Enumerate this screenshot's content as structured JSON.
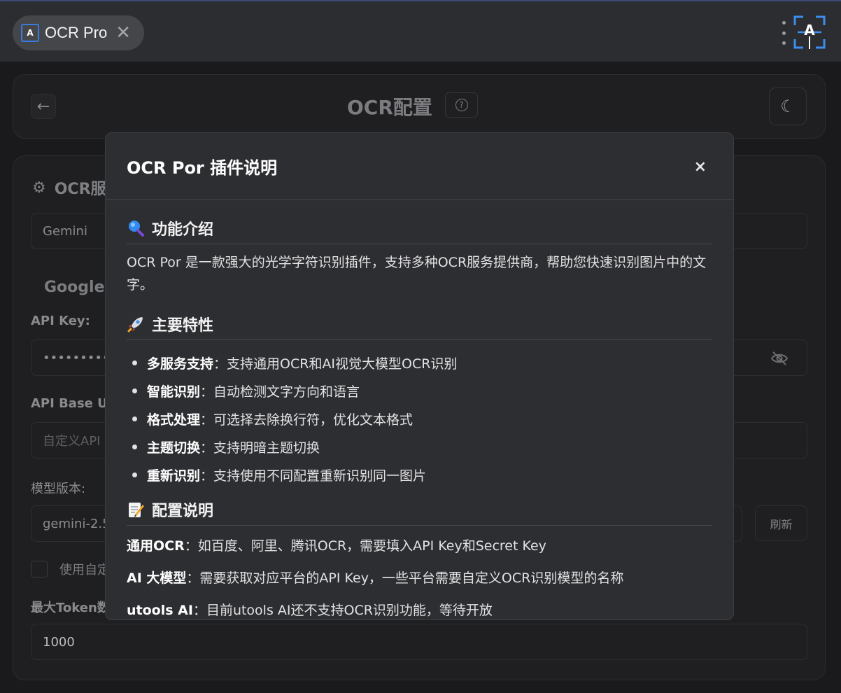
{
  "topbar": {
    "tab_title": "OCR Pro",
    "tab_close": "✕"
  },
  "header": {
    "back": "←",
    "title": "OCR配置",
    "help": "?",
    "theme": "☾"
  },
  "settings": {
    "section_title": "OCR服",
    "provider_value": "Gemini",
    "subhead": "Google G",
    "api_key_label": "API Key:",
    "api_key_value": "•••••••••••",
    "api_base_label": "API Base UR",
    "api_base_placeholder": "自定义API",
    "model_label": "模型版本:",
    "model_value": "gemini-2.5",
    "refresh_label": "刷新",
    "checkbox_label": "使用自定",
    "max_token_label": "最大Token数",
    "max_token_value": "1000"
  },
  "modal": {
    "title": "OCR Por 插件说明",
    "close": "×",
    "intro_heading": "功能介绍",
    "intro_text": "OCR Por 是一款强大的光学字符识别插件，支持多种OCR服务提供商，帮助您快速识别图片中的文字。",
    "features_heading": "主要特性",
    "features": [
      {
        "name": "多服务支持",
        "desc": "：支持通用OCR和AI视觉大模型OCR识别"
      },
      {
        "name": "智能识别",
        "desc": "：自动检测文字方向和语言"
      },
      {
        "name": "格式处理",
        "desc": "：可选择去除换行符，优化文本格式"
      },
      {
        "name": "主题切换",
        "desc": "：支持明暗主题切换"
      },
      {
        "name": "重新识别",
        "desc": "：支持使用不同配置重新识别同一图片"
      }
    ],
    "config_heading": "配置说明",
    "config": [
      {
        "name": "通用OCR",
        "desc": "：如百度、阿里、腾讯OCR，需要填入API Key和Secret Key"
      },
      {
        "name": "AI 大模型",
        "desc": "：需要获取对应平台的API Key，一些平台需要自定义OCR识别模型的名称"
      },
      {
        "name": "utools AI",
        "desc": "：目前utools AI还不支持OCR识别功能，等待开放"
      }
    ]
  }
}
